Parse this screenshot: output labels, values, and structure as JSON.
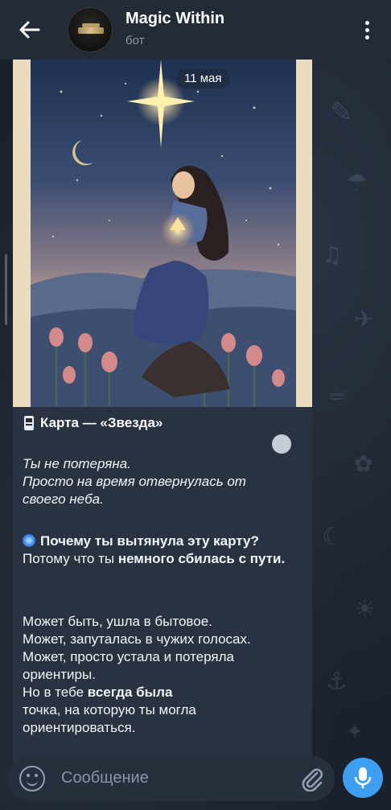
{
  "header": {
    "title": "Magic Within",
    "subtitle": "бот"
  },
  "message": {
    "date": "11 мая",
    "card_title": "Карта — «Звезда»",
    "intro_lines": [
      "Ты не потеряна.",
      "Просто на время отвернулась от",
      "своего неба."
    ],
    "question": "Почему ты вытянула эту карту?",
    "answer_plain": "Потому что ты ",
    "answer_bold": "немного сбилась с пути.",
    "para_lines": [
      "Может быть, ушла в бытовое.",
      "Может, запуталась в чужих голосах.",
      "Может, просто устала и потеряла",
      "ориентиры."
    ],
    "closing_plain_1": "Но в тебе ",
    "closing_bold": "всегда была",
    "closing_line_2": "точка, на которую ты могла",
    "closing_line_3": "ориентироваться."
  },
  "input": {
    "placeholder": "Сообщение"
  },
  "icons": {
    "back": "arrow-left-icon",
    "menu": "more-vertical-icon",
    "emoji": "smile-icon",
    "attach": "paperclip-icon",
    "mic": "microphone-icon"
  },
  "colors": {
    "header_bg": "#232b37",
    "bubble_bg": "#283241",
    "accent": "#3e9ef1"
  }
}
